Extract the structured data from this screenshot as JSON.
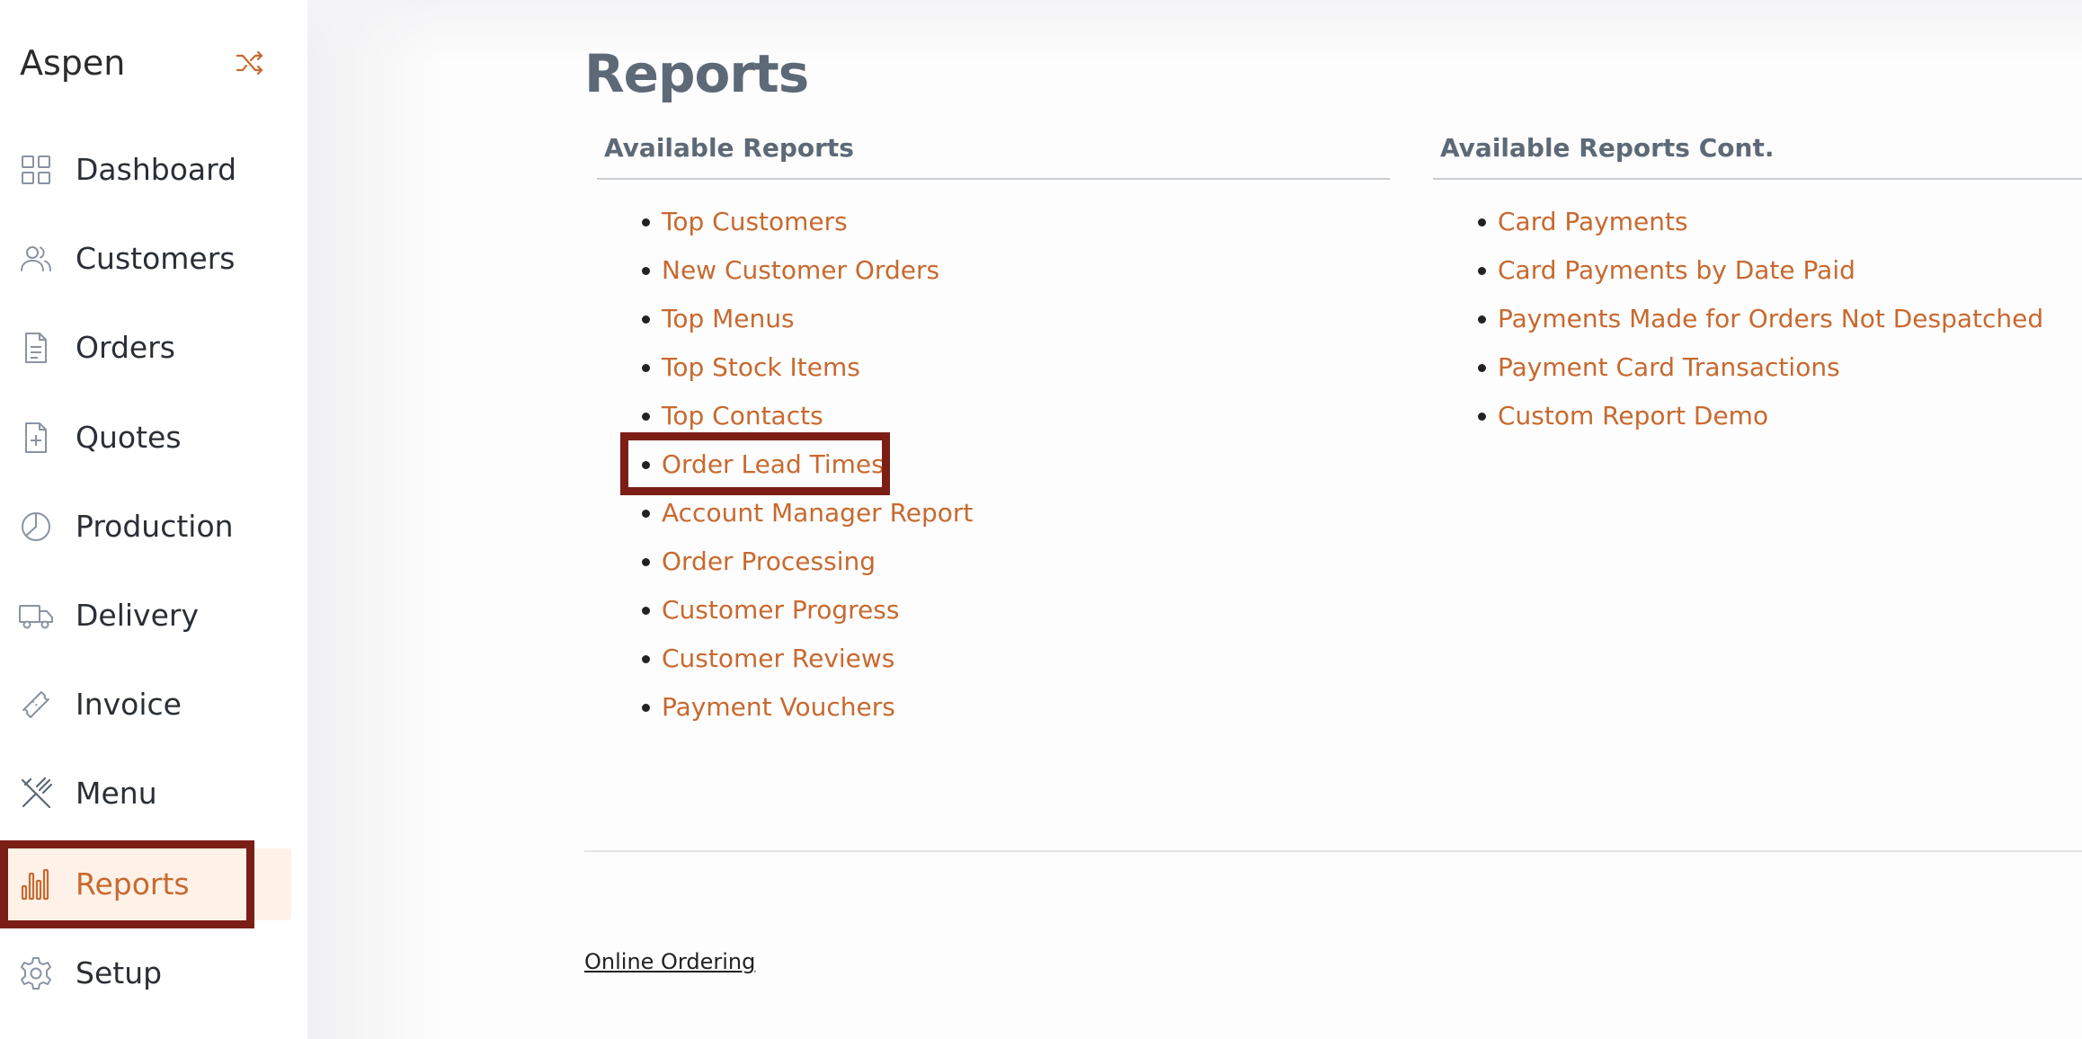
{
  "app": {
    "brand": "Aspen"
  },
  "sidebar": {
    "items": [
      {
        "label": "Dashboard",
        "icon": "grid-icon"
      },
      {
        "label": "Customers",
        "icon": "users-icon"
      },
      {
        "label": "Orders",
        "icon": "document-icon"
      },
      {
        "label": "Quotes",
        "icon": "file-plus-icon"
      },
      {
        "label": "Production",
        "icon": "pie-chart-icon"
      },
      {
        "label": "Delivery",
        "icon": "truck-icon"
      },
      {
        "label": "Invoice",
        "icon": "ticket-icon"
      },
      {
        "label": "Menu",
        "icon": "utensils-icon"
      },
      {
        "label": "Reports",
        "icon": "bar-chart-icon",
        "active": true
      },
      {
        "label": "Setup",
        "icon": "gear-icon"
      }
    ]
  },
  "main": {
    "title": "Reports",
    "left_column": {
      "heading": "Available Reports",
      "links": [
        "Top Customers",
        "New Customer Orders",
        "Top Menus",
        "Top Stock Items",
        "Top Contacts",
        "Order Lead Times",
        "Account Manager Report",
        "Order Processing",
        "Customer Progress",
        "Customer Reviews",
        "Payment Vouchers"
      ]
    },
    "right_column": {
      "heading": "Available Reports Cont.",
      "links": [
        "Card Payments",
        "Card Payments by Date Paid",
        "Payments Made for Orders Not Despatched",
        "Payment Card Transactions",
        "Custom Report Demo"
      ]
    }
  },
  "footer": {
    "link": "Online Ordering"
  },
  "colors": {
    "accent": "#c8692f",
    "heading": "#5d6977",
    "active_bg": "#fdf1e8",
    "highlight_outline": "#7b1f16"
  }
}
